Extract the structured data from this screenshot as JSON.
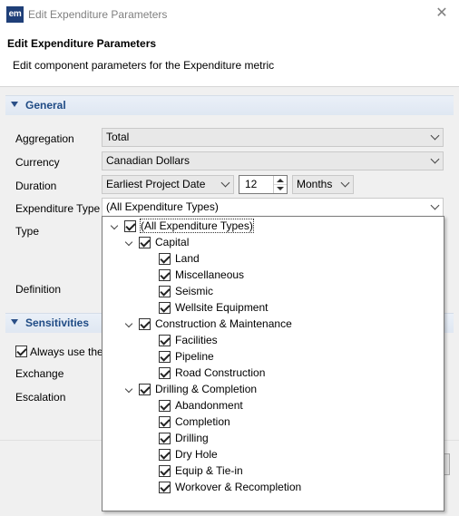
{
  "window": {
    "app_icon_text": "em",
    "title": "Edit Expenditure Parameters"
  },
  "header": {
    "title": "Edit Expenditure Parameters",
    "description": "Edit component parameters for the Expenditure metric"
  },
  "general": {
    "section_label": "General",
    "aggregation": {
      "label": "Aggregation",
      "value": "Total"
    },
    "currency": {
      "label": "Currency",
      "value": "Canadian Dollars"
    },
    "duration": {
      "label": "Duration",
      "start": "Earliest Project Date",
      "count": "12",
      "unit": "Months"
    },
    "expenditure_type": {
      "label": "Expenditure Type",
      "value": "(All Expenditure Types)"
    },
    "type_label": "Type",
    "definition_label": "Definition"
  },
  "sensitivities": {
    "section_label": "Sensitivities",
    "always_use_label": "Always use the",
    "exchange_label": "Exchange",
    "escalation_label": "Escalation"
  },
  "tree": {
    "root": {
      "label": "(All Expenditure Types)",
      "checked": true
    },
    "groups": [
      {
        "label": "Capital",
        "checked": true,
        "items": [
          "Land",
          "Miscellaneous",
          "Seismic",
          "Wellsite Equipment"
        ]
      },
      {
        "label": "Construction & Maintenance",
        "checked": true,
        "items": [
          "Facilities",
          "Pipeline",
          "Road Construction"
        ]
      },
      {
        "label": "Drilling & Completion",
        "checked": true,
        "items": [
          "Abandonment",
          "Completion",
          "Drilling",
          "Dry Hole",
          "Equip & Tie-in",
          "Workover & Recompletion"
        ]
      }
    ]
  }
}
